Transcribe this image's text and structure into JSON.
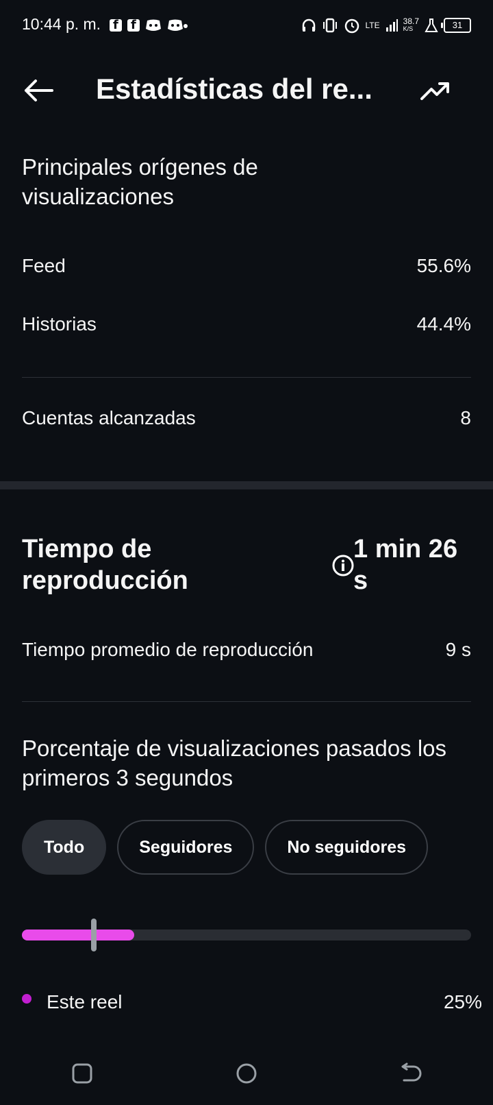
{
  "status_bar": {
    "time": "10:44 p. m.",
    "network": "LTE",
    "speed": "38.7",
    "speed_unit": "K/S",
    "battery": "31"
  },
  "header": {
    "title": "Estadísticas del re..."
  },
  "sources": {
    "title": "Principales orígenes de visualizaciones",
    "rows": [
      {
        "label": "Feed",
        "value": "55.6%"
      },
      {
        "label": "Historias",
        "value": "44.4%"
      }
    ]
  },
  "reach": {
    "label": "Cuentas alcanzadas",
    "value": "8"
  },
  "playtime": {
    "title": "Tiempo de reproducción",
    "value": "1 min 26 s",
    "avg_label": "Tiempo promedio de reproducción",
    "avg_value": "9 s"
  },
  "retention": {
    "title": "Porcentaje de visualizaciones pasados los primeros 3 segundos",
    "tabs": [
      "Todo",
      "Seguidores",
      "No seguidores"
    ],
    "selected_tab": "Todo",
    "progress_fraction": 0.25,
    "marker_fraction": 0.16,
    "legend_label": "Este reel",
    "legend_value": "25%",
    "accent_color": "#e94bea",
    "dot_color": "#c21fd0"
  },
  "icons": {
    "back": "back-arrow-icon",
    "trend": "trending-up-icon",
    "info": "info-icon"
  }
}
